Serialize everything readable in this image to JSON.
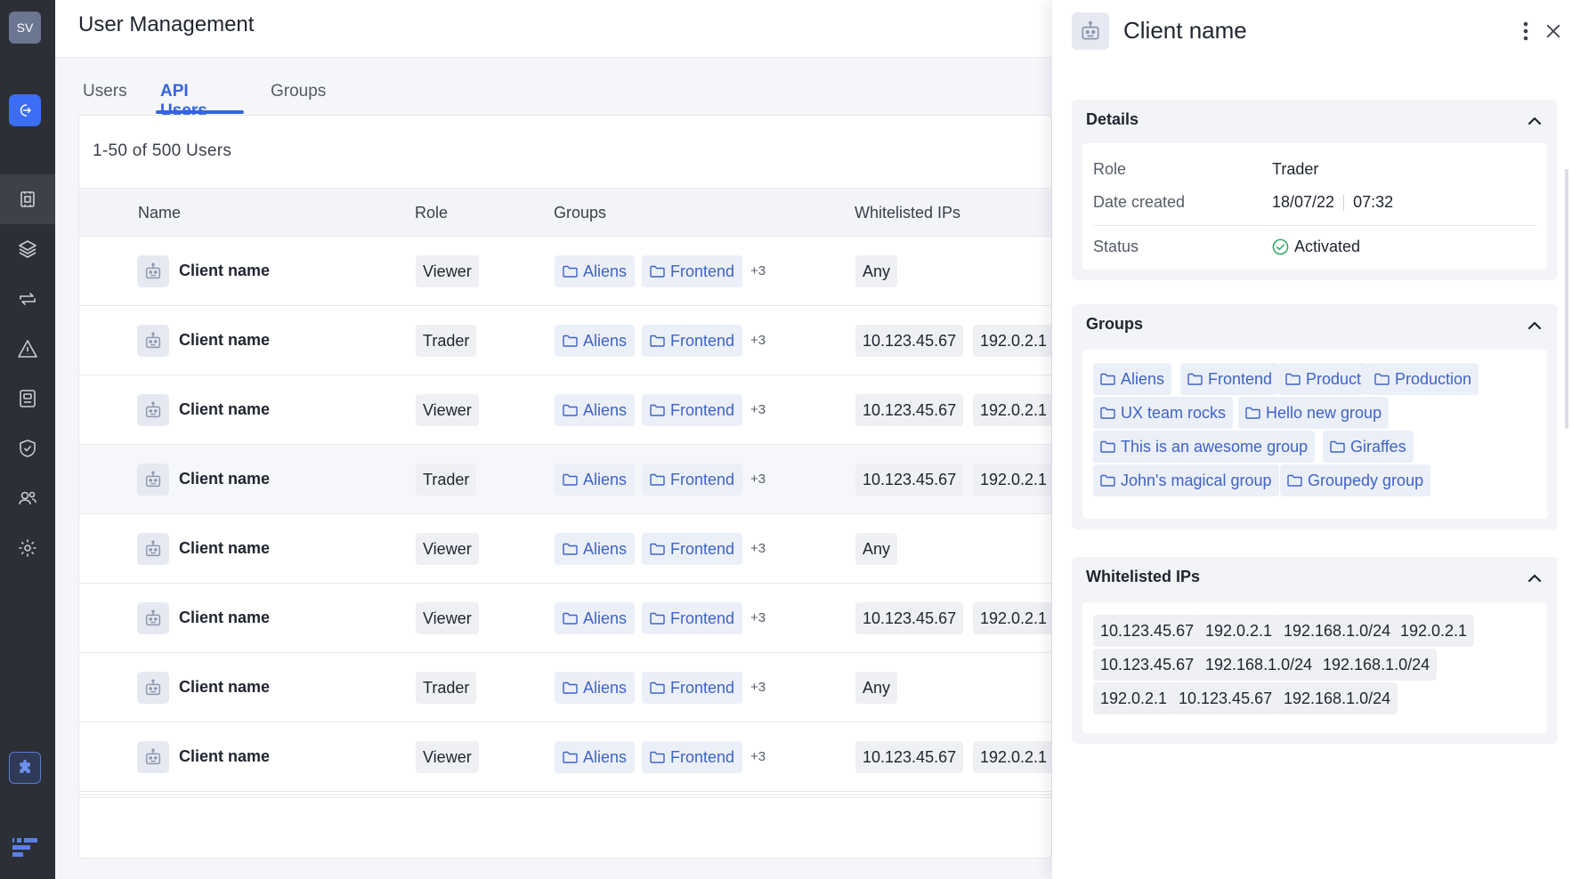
{
  "sidebar": {
    "avatar_initials": "SV",
    "items": [
      {
        "icon": "cpu-chip-icon",
        "active": true
      },
      {
        "icon": "layers-icon",
        "active": false
      },
      {
        "icon": "transfer-arrows-icon",
        "active": false
      },
      {
        "icon": "warning-triangle-icon",
        "active": false
      },
      {
        "icon": "clipboard-icon",
        "active": false
      },
      {
        "icon": "shield-check-icon",
        "active": false
      },
      {
        "icon": "users-icon",
        "active": false
      },
      {
        "icon": "gear-icon",
        "active": false
      }
    ],
    "plugin_icon": "puzzle-icon",
    "accent": "#3b6ef5"
  },
  "header": {
    "title": "User Management"
  },
  "tabs": [
    {
      "label": "Users",
      "active": false
    },
    {
      "label": "API Users",
      "active": true
    },
    {
      "label": "Groups",
      "active": false
    }
  ],
  "table": {
    "count_text": "1-50 of 500 Users",
    "columns": [
      "Name",
      "Role",
      "Groups",
      "Whitelisted IPs"
    ],
    "rows": [
      {
        "name": "Client name",
        "role": "Viewer",
        "groups": [
          "Aliens",
          "Frontend"
        ],
        "more": "+3",
        "ips": [
          "Any"
        ]
      },
      {
        "name": "Client name",
        "role": "Trader",
        "groups": [
          "Aliens",
          "Frontend"
        ],
        "more": "+3",
        "ips": [
          "10.123.45.67",
          "192.0.2.1"
        ]
      },
      {
        "name": "Client name",
        "role": "Viewer",
        "groups": [
          "Aliens",
          "Frontend"
        ],
        "more": "+3",
        "ips": [
          "10.123.45.67",
          "192.0.2.1"
        ]
      },
      {
        "name": "Client name",
        "role": "Trader",
        "groups": [
          "Aliens",
          "Frontend"
        ],
        "more": "+3",
        "ips": [
          "10.123.45.67",
          "192.0.2.1"
        ]
      },
      {
        "name": "Client name",
        "role": "Viewer",
        "groups": [
          "Aliens",
          "Frontend"
        ],
        "more": "+3",
        "ips": [
          "Any"
        ]
      },
      {
        "name": "Client name",
        "role": "Viewer",
        "groups": [
          "Aliens",
          "Frontend"
        ],
        "more": "+3",
        "ips": [
          "10.123.45.67",
          "192.0.2.1"
        ]
      },
      {
        "name": "Client name",
        "role": "Trader",
        "groups": [
          "Aliens",
          "Frontend"
        ],
        "more": "+3",
        "ips": [
          "Any"
        ]
      },
      {
        "name": "Client name",
        "role": "Viewer",
        "groups": [
          "Aliens",
          "Frontend"
        ],
        "more": "+3",
        "ips": [
          "10.123.45.67",
          "192.0.2.1"
        ]
      }
    ]
  },
  "drawer": {
    "title": "Client name",
    "details": {
      "heading": "Details",
      "role_label": "Role",
      "role_value": "Trader",
      "date_label": "Date created",
      "date_value": "18/07/22",
      "time_value": "07:32",
      "status_label": "Status",
      "status_value": "Activated",
      "status_color": "#2fa866"
    },
    "groups": {
      "heading": "Groups",
      "items": [
        "Aliens",
        "Frontend",
        "Product",
        "Production",
        "UX team rocks",
        "Hello new group",
        "This is an awesome group",
        "Giraffes",
        "John's magical group",
        "Groupedy group"
      ]
    },
    "ips": {
      "heading": "Whitelisted IPs",
      "items": [
        "10.123.45.67",
        "192.0.2.1",
        "192.168.1.0/24",
        "192.0.2.1",
        "10.123.45.67",
        "192.168.1.0/24",
        "192.168.1.0/24",
        "192.0.2.1",
        "10.123.45.67",
        "192.168.1.0/24"
      ]
    }
  }
}
